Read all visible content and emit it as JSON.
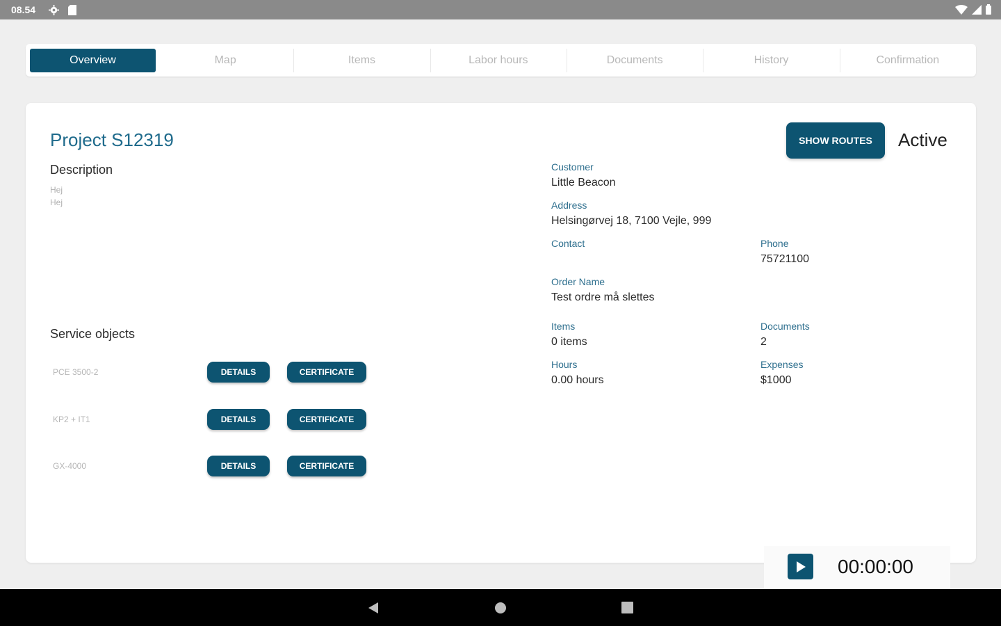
{
  "status_bar": {
    "time": "08.54"
  },
  "tabs": [
    {
      "label": "Overview",
      "active": true
    },
    {
      "label": "Map",
      "active": false
    },
    {
      "label": "Items",
      "active": false
    },
    {
      "label": "Labor hours",
      "active": false
    },
    {
      "label": "Documents",
      "active": false
    },
    {
      "label": "History",
      "active": false
    },
    {
      "label": "Confirmation",
      "active": false
    }
  ],
  "project": {
    "title": "Project S12319",
    "status": "Active",
    "show_routes_label": "SHOW ROUTES",
    "description_heading": "Description",
    "description_lines": [
      "Hej",
      "Hej"
    ]
  },
  "fields": {
    "customer": {
      "label": "Customer",
      "value": "Little Beacon"
    },
    "address": {
      "label": "Address",
      "value": "Helsingørvej 18, 7100 Vejle, 999"
    },
    "contact": {
      "label": "Contact",
      "value": ""
    },
    "phone": {
      "label": "Phone",
      "value": "75721100"
    },
    "order_name": {
      "label": "Order Name",
      "value": "Test ordre må slettes"
    },
    "items": {
      "label": "Items",
      "value": "0 items"
    },
    "documents": {
      "label": "Documents",
      "value": "2"
    },
    "hours": {
      "label": "Hours",
      "value": "0.00 hours"
    },
    "expenses": {
      "label": "Expenses",
      "value": "$1000"
    }
  },
  "service_objects": {
    "heading": "Service objects",
    "details_label": "DETAILS",
    "certificate_label": "CERTIFICATE",
    "items": [
      {
        "name": "PCE 3500-2"
      },
      {
        "name": "KP2 + IT1"
      },
      {
        "name": "GX-4000"
      }
    ]
  },
  "timer": {
    "value": "00:00:00",
    "icon": "play-icon"
  },
  "colors": {
    "primary": "#0d5471",
    "label": "#2e6f8e",
    "title": "#1f6b8c"
  }
}
